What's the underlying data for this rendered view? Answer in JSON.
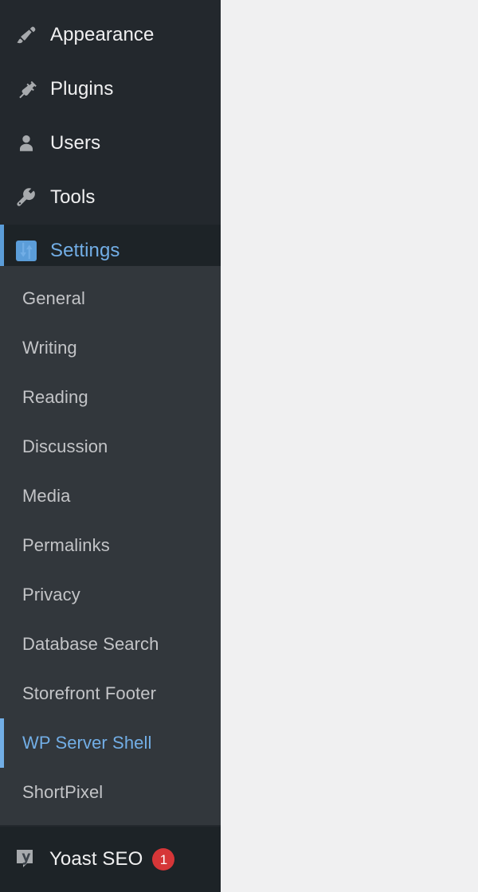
{
  "sidebar": {
    "background": "#23282d",
    "submenu_background": "#32373c",
    "footer_background": "#1d2327",
    "accent_color": "#72aee6",
    "indicator_color": "#5b9dd9",
    "top_items": [
      {
        "label": "Appearance",
        "icon": "paintbrush-icon"
      },
      {
        "label": "Plugins",
        "icon": "plug-icon"
      },
      {
        "label": "Users",
        "icon": "user-icon"
      },
      {
        "label": "Tools",
        "icon": "wrench-icon"
      },
      {
        "label": "Settings",
        "icon": "settings-sliders-icon"
      }
    ],
    "submenu": {
      "parent": "Settings",
      "items": [
        {
          "label": "General"
        },
        {
          "label": "Writing"
        },
        {
          "label": "Reading"
        },
        {
          "label": "Discussion"
        },
        {
          "label": "Media"
        },
        {
          "label": "Permalinks"
        },
        {
          "label": "Privacy"
        },
        {
          "label": "Database Search"
        },
        {
          "label": "Storefront Footer"
        },
        {
          "label": "WP Server Shell"
        },
        {
          "label": "ShortPixel"
        }
      ]
    },
    "footer": {
      "label": "Yoast SEO",
      "icon": "yoast-logo-icon",
      "badge_count": "1",
      "badge_color": "#d63638"
    }
  },
  "content": {
    "background": "#f0f0f1"
  }
}
